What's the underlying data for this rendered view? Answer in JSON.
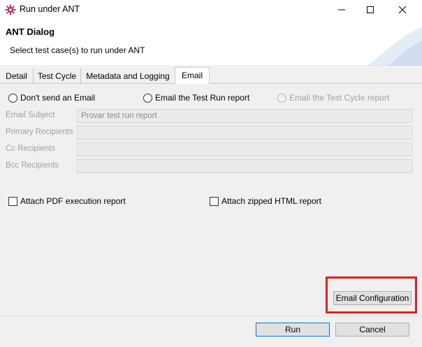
{
  "window": {
    "title": "Run under ANT",
    "controls": [
      "minimize",
      "maximize",
      "close"
    ]
  },
  "header": {
    "title": "ANT Dialog",
    "message": "Select test case(s) to run under ANT"
  },
  "tabs": [
    {
      "label": "Detail",
      "active": false
    },
    {
      "label": "Test Cycle",
      "active": false
    },
    {
      "label": "Metadata and Logging",
      "active": false
    },
    {
      "label": "Email",
      "active": true
    }
  ],
  "email_options": {
    "dont_send": "Don't send an Email",
    "test_run_report": "Email the Test Run report",
    "test_cycle_report": "Email the Test Cycle report"
  },
  "fields": {
    "subject_label": "Email Subject",
    "subject_value": "Provar test run report",
    "primary_label": "Primary Recipients",
    "primary_value": "",
    "cc_label": "Cc Recipients",
    "cc_value": "",
    "bcc_label": "Bcc Recipients",
    "bcc_value": ""
  },
  "attachments": {
    "pdf_label": "Attach PDF execution report",
    "pdf_checked": false,
    "html_label": "Attach zipped HTML report",
    "html_checked": false
  },
  "buttons": {
    "email_config": "Email Configuration",
    "run": "Run",
    "cancel": "Cancel"
  },
  "colors": {
    "highlight": "#e0201e",
    "icon": "#b8356e",
    "default_button_border": "#0078d7"
  }
}
